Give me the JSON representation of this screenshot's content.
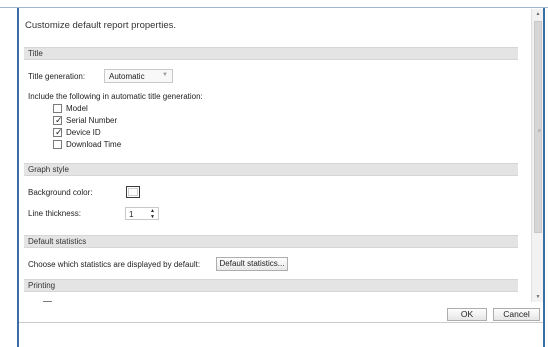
{
  "intro": "Customize default report properties.",
  "sections": {
    "title": {
      "header": "Title",
      "title_generation_label": "Title generation:",
      "title_generation_value": "Automatic",
      "include_label": "Include the following in automatic title generation:",
      "options": [
        {
          "label": "Model",
          "checked": false
        },
        {
          "label": "Serial Number",
          "checked": true
        },
        {
          "label": "Device ID",
          "checked": true
        },
        {
          "label": "Download Time",
          "checked": false
        }
      ]
    },
    "graph_style": {
      "header": "Graph style",
      "background_label": "Background color:",
      "background_color": "#ffffff",
      "line_thickness_label": "Line thickness:",
      "line_thickness_value": "1"
    },
    "default_statistics": {
      "header": "Default statistics",
      "choose_label": "Choose which statistics are displayed by default:",
      "button_label": "Default statistics..."
    },
    "printing": {
      "header": "Printing"
    }
  },
  "icons": {
    "checkmark": "✓",
    "dropdown": "▼",
    "spin_up": "▲",
    "spin_down": "▼",
    "scroll_up": "▲",
    "scroll_down": "▼",
    "grip": "≡"
  },
  "footer": {
    "ok_label": "OK",
    "cancel_label": "Cancel"
  },
  "colors": {
    "frame_accent": "#3b6ea5",
    "section_header_bg": "#e4e4e4"
  }
}
